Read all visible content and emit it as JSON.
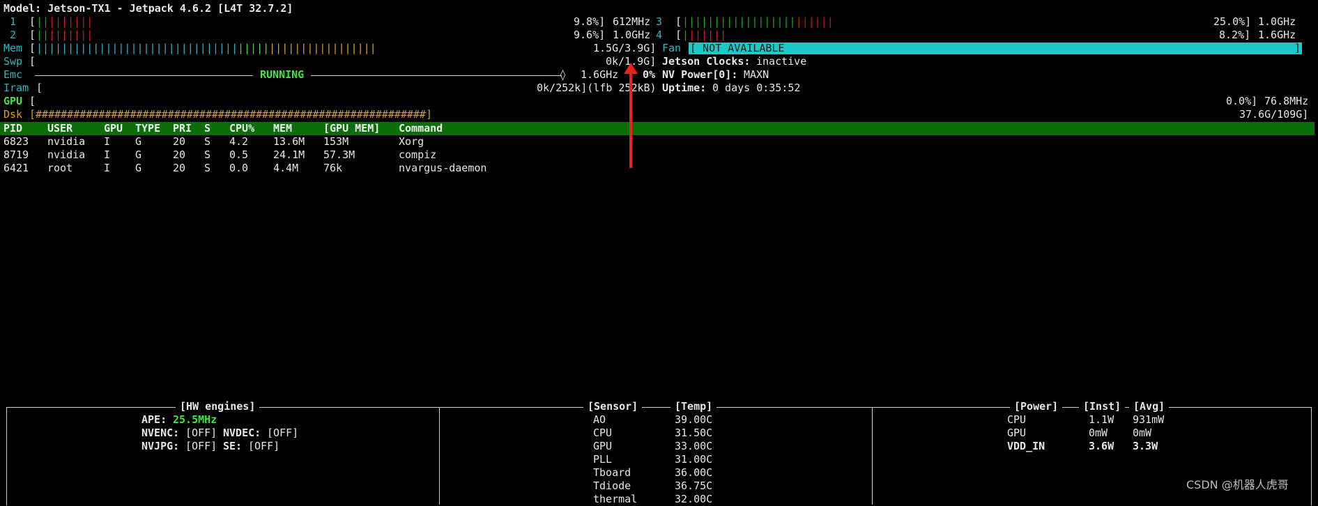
{
  "model_line": "Model: Jetson-TX1 - Jetpack 4.6.2 [L4T 32.7.2]",
  "cpus": [
    {
      "label": "1",
      "percent": "9.8%]",
      "freq": "612MHz"
    },
    {
      "label": "2",
      "percent": "9.6%]",
      "freq": "1.0GHz"
    },
    {
      "label": "3",
      "percent": "25.0%]",
      "freq": "1.0GHz"
    },
    {
      "label": "4",
      "percent": "8.2%]",
      "freq": "1.6GHz"
    }
  ],
  "mem": {
    "label": "Mem",
    "value": "1.5G/3.9G]"
  },
  "swp": {
    "label": "Swp",
    "value": "0k/1.9G]"
  },
  "emc": {
    "label": "Emc",
    "status": "RUNNING",
    "freq": "1.6GHz",
    "percent": "0%"
  },
  "iram": {
    "label": "Iram",
    "value": "0k/252k](lfb 252kB)"
  },
  "gpu": {
    "label": "GPU",
    "value": "0.0%]",
    "freq": "76.8MHz"
  },
  "dsk": {
    "label": "Dsk",
    "value": "37.6G/109G]"
  },
  "fan": {
    "label": "Fan",
    "status": "[ NOT AVAILABLE"
  },
  "jetson_clocks": {
    "label": "Jetson Clocks:",
    "value": "inactive"
  },
  "nv_power": {
    "label": "NV Power[0]:",
    "value": "MAXN"
  },
  "uptime": {
    "label": "Uptime:",
    "value": "0 days 0:35:52"
  },
  "table": {
    "headers": [
      "PID",
      "USER",
      "GPU",
      "TYPE",
      "PRI",
      "S",
      "CPU%",
      "MEM",
      "[GPU MEM]",
      "Command"
    ],
    "rows": [
      [
        "6823",
        "nvidia",
        "I",
        "G",
        "20",
        "S",
        "4.2",
        "13.6M",
        "153M",
        "Xorg"
      ],
      [
        "8719",
        "nvidia",
        "I",
        "G",
        "20",
        "S",
        "0.5",
        "24.1M",
        "57.3M",
        "compiz"
      ],
      [
        "6421",
        "root",
        "I",
        "G",
        "20",
        "S",
        "0.0",
        "4.4M",
        "76k",
        "nvargus-daemon"
      ]
    ]
  },
  "hw": {
    "title": "[HW engines]",
    "ape_label": "APE:",
    "ape_value": "25.5MHz",
    "nvenc_label": "NVENC:",
    "nvenc_value": "[OFF]",
    "nvdec_label": "NVDEC:",
    "nvdec_value": "[OFF]",
    "nvjpg_label": "NVJPG:",
    "nvjpg_value": "[OFF]",
    "se_label": "SE:",
    "se_value": "[OFF]"
  },
  "sensors": {
    "title_sensor": "[Sensor]",
    "title_temp": "[Temp]",
    "items": [
      {
        "name": "AO",
        "temp": "39.00C"
      },
      {
        "name": "CPU",
        "temp": "31.50C"
      },
      {
        "name": "GPU",
        "temp": "33.00C"
      },
      {
        "name": "PLL",
        "temp": "31.00C"
      },
      {
        "name": "Tboard",
        "temp": "36.00C"
      },
      {
        "name": "Tdiode",
        "temp": "36.75C"
      },
      {
        "name": "thermal",
        "temp": "32.00C"
      }
    ]
  },
  "power": {
    "title_power": "[Power]",
    "title_inst": "[Inst]",
    "title_avg": "[Avg]",
    "items": [
      {
        "name": "CPU",
        "inst": "1.1W",
        "avg": "931mW"
      },
      {
        "name": "GPU",
        "inst": "0mW",
        "avg": "0mW"
      },
      {
        "name": "VDD_IN",
        "inst": "3.6W",
        "avg": "3.3W"
      }
    ]
  },
  "watermark": "CSDN @机器人虎哥",
  "colors": {
    "cyan": "#25b8c4",
    "header_green": "#0b6e0b",
    "fan_bg": "#1bc9c9",
    "arrow": "#e8231d"
  }
}
